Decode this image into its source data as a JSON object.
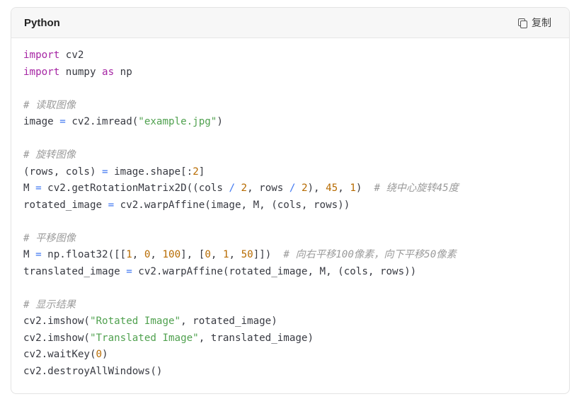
{
  "header": {
    "language": "Python",
    "copy_label": "复制",
    "copy_icon": "copy-icon"
  },
  "code": {
    "lines": [
      [
        {
          "t": "import",
          "c": "kw"
        },
        {
          "t": " cv2",
          "c": "p"
        }
      ],
      [
        {
          "t": "import",
          "c": "kw"
        },
        {
          "t": " numpy ",
          "c": "p"
        },
        {
          "t": "as",
          "c": "kw"
        },
        {
          "t": " np",
          "c": "p"
        }
      ],
      [],
      [
        {
          "t": "# 读取图像",
          "c": "cmt"
        }
      ],
      [
        {
          "t": "image ",
          "c": "p"
        },
        {
          "t": "=",
          "c": "op"
        },
        {
          "t": " cv2.imread(",
          "c": "p"
        },
        {
          "t": "\"example.jpg\"",
          "c": "str"
        },
        {
          "t": ")",
          "c": "p"
        }
      ],
      [],
      [
        {
          "t": "# 旋转图像",
          "c": "cmt"
        }
      ],
      [
        {
          "t": "(rows, cols) ",
          "c": "p"
        },
        {
          "t": "=",
          "c": "op"
        },
        {
          "t": " image.shape[:",
          "c": "p"
        },
        {
          "t": "2",
          "c": "num"
        },
        {
          "t": "]",
          "c": "p"
        }
      ],
      [
        {
          "t": "M ",
          "c": "p"
        },
        {
          "t": "=",
          "c": "op"
        },
        {
          "t": " cv2.getRotationMatrix2D((cols ",
          "c": "p"
        },
        {
          "t": "/",
          "c": "op"
        },
        {
          "t": " ",
          "c": "p"
        },
        {
          "t": "2",
          "c": "num"
        },
        {
          "t": ", rows ",
          "c": "p"
        },
        {
          "t": "/",
          "c": "op"
        },
        {
          "t": " ",
          "c": "p"
        },
        {
          "t": "2",
          "c": "num"
        },
        {
          "t": "), ",
          "c": "p"
        },
        {
          "t": "45",
          "c": "num"
        },
        {
          "t": ", ",
          "c": "p"
        },
        {
          "t": "1",
          "c": "num"
        },
        {
          "t": ")  ",
          "c": "p"
        },
        {
          "t": "# 绕中心旋转45度",
          "c": "cmt"
        }
      ],
      [
        {
          "t": "rotated_image ",
          "c": "p"
        },
        {
          "t": "=",
          "c": "op"
        },
        {
          "t": " cv2.warpAffine(image, M, (cols, rows))",
          "c": "p"
        }
      ],
      [],
      [
        {
          "t": "# 平移图像",
          "c": "cmt"
        }
      ],
      [
        {
          "t": "M ",
          "c": "p"
        },
        {
          "t": "=",
          "c": "op"
        },
        {
          "t": " np.float32([[",
          "c": "p"
        },
        {
          "t": "1",
          "c": "num"
        },
        {
          "t": ", ",
          "c": "p"
        },
        {
          "t": "0",
          "c": "num"
        },
        {
          "t": ", ",
          "c": "p"
        },
        {
          "t": "100",
          "c": "num"
        },
        {
          "t": "], [",
          "c": "p"
        },
        {
          "t": "0",
          "c": "num"
        },
        {
          "t": ", ",
          "c": "p"
        },
        {
          "t": "1",
          "c": "num"
        },
        {
          "t": ", ",
          "c": "p"
        },
        {
          "t": "50",
          "c": "num"
        },
        {
          "t": "]])  ",
          "c": "p"
        },
        {
          "t": "# 向右平移100像素，向下平移50像素",
          "c": "cmt"
        }
      ],
      [
        {
          "t": "translated_image ",
          "c": "p"
        },
        {
          "t": "=",
          "c": "op"
        },
        {
          "t": " cv2.warpAffine(rotated_image, M, (cols, rows))",
          "c": "p"
        }
      ],
      [],
      [
        {
          "t": "# 显示结果",
          "c": "cmt"
        }
      ],
      [
        {
          "t": "cv2.imshow(",
          "c": "p"
        },
        {
          "t": "\"Rotated Image\"",
          "c": "str"
        },
        {
          "t": ", rotated_image)",
          "c": "p"
        }
      ],
      [
        {
          "t": "cv2.imshow(",
          "c": "p"
        },
        {
          "t": "\"Translated Image\"",
          "c": "str"
        },
        {
          "t": ", translated_image)",
          "c": "p"
        }
      ],
      [
        {
          "t": "cv2.waitKey(",
          "c": "p"
        },
        {
          "t": "0",
          "c": "num"
        },
        {
          "t": ")",
          "c": "p"
        }
      ],
      [
        {
          "t": "cv2.destroyAllWindows()",
          "c": "p"
        }
      ]
    ]
  }
}
